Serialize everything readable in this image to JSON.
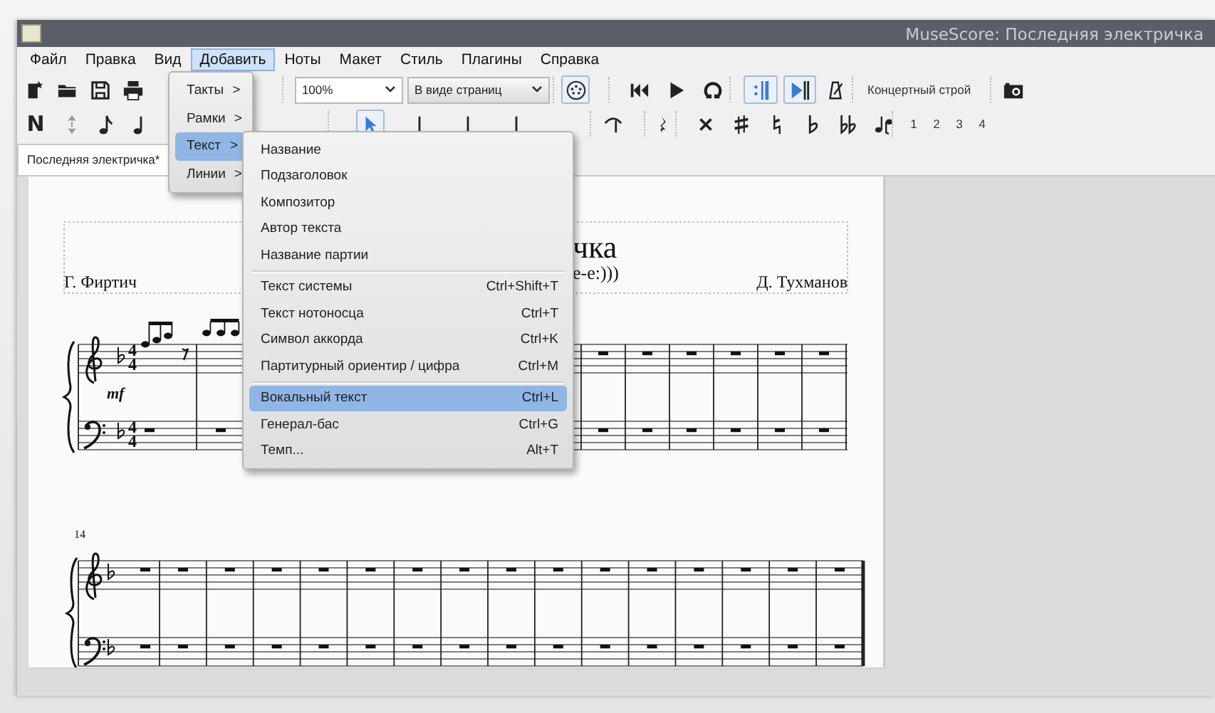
{
  "window": {
    "title": "MuseScore: Последняя электричка"
  },
  "menubar": [
    {
      "label": "Файл",
      "selected": false
    },
    {
      "label": "Правка",
      "selected": false
    },
    {
      "label": "Вид",
      "selected": false
    },
    {
      "label": "Добавить",
      "selected": true
    },
    {
      "label": "Ноты",
      "selected": false
    },
    {
      "label": "Макет",
      "selected": false
    },
    {
      "label": "Стиль",
      "selected": false
    },
    {
      "label": "Плагины",
      "selected": false
    },
    {
      "label": "Справка",
      "selected": false
    }
  ],
  "toolbar_row_1": [
    [
      {
        "kind": "new-file"
      },
      {
        "kind": "open-folder"
      },
      {
        "kind": "save"
      },
      {
        "kind": "print"
      }
    ],
    [
      {
        "kind": "combo",
        "value": "100%"
      },
      {
        "kind": "combo",
        "value": "В виде страниц"
      }
    ],
    [
      {
        "kind": "midi",
        "on": true
      }
    ],
    [
      {
        "kind": "rewind"
      },
      {
        "kind": "play"
      },
      {
        "kind": "loop"
      }
    ],
    [
      {
        "kind": "repeat",
        "on": true
      },
      {
        "kind": "pan",
        "on": true
      },
      {
        "kind": "metronome",
        "on": false
      }
    ],
    [
      {
        "kind": "text-toggle",
        "label": "Концертный строй",
        "on": false
      }
    ],
    [
      {
        "kind": "camera"
      }
    ]
  ],
  "toolbar_row_2": [
    [
      {
        "kind": "glyph",
        "text": "N",
        "on": false
      },
      {
        "kind": "up-down"
      },
      {
        "kind": "eighth-note"
      },
      {
        "kind": "quarter-note"
      }
    ],
    [
      {
        "kind": "cursor-note",
        "on": true
      },
      {
        "kind": "stem"
      },
      {
        "kind": "stem"
      },
      {
        "kind": "stem"
      }
    ],
    [
      {
        "kind": "hook"
      }
    ],
    [
      {
        "kind": "rest"
      }
    ],
    [
      {
        "kind": "double-sharp"
      },
      {
        "kind": "sharp"
      },
      {
        "kind": "natural"
      },
      {
        "kind": "flat"
      },
      {
        "kind": "double-flat"
      },
      {
        "kind": "flip"
      }
    ],
    [
      {
        "kind": "voice",
        "text": "1"
      },
      {
        "kind": "voice",
        "text": "2"
      },
      {
        "kind": "voice",
        "text": "3"
      },
      {
        "kind": "voice",
        "text": "4"
      }
    ]
  ],
  "tabs": [
    {
      "label": "Последняя электричка*",
      "selected": true
    }
  ],
  "score": {
    "title": "чка",
    "subtitle": "e-e:)))",
    "lyricist": "Г. Фиртич",
    "composer": "Д. Тухманов",
    "treble_time_signature": [
      "4",
      "4"
    ],
    "bass_time_signature": [
      "4",
      "4"
    ],
    "dynamic": "mf",
    "measure_number": "14"
  },
  "add_menu": [
    {
      "label": "Такты",
      "arrow": ">",
      "selected": false
    },
    {
      "label": "Рамки",
      "arrow": ">",
      "selected": false
    },
    {
      "label": "Текст",
      "arrow": ">",
      "selected": true
    },
    {
      "label": "Линии",
      "arrow": ">",
      "selected": false
    }
  ],
  "text_submenu": [
    [
      {
        "label": "Название",
        "selected": false
      },
      {
        "label": "Подзаголовок",
        "selected": false
      },
      {
        "label": "Композитор",
        "selected": false
      },
      {
        "label": "Автор текста",
        "selected": false
      },
      {
        "label": "Название партии",
        "selected": false
      }
    ],
    [
      {
        "label": "Текст системы",
        "shortcut": "Ctrl+Shift+T",
        "selected": false
      },
      {
        "label": "Текст нотоносца",
        "shortcut": "Ctrl+T",
        "selected": false
      },
      {
        "label": "Символ аккорда",
        "shortcut": "Ctrl+K",
        "selected": false
      },
      {
        "label": "Партитурный ориентир / цифра",
        "shortcut": "Ctrl+M",
        "selected": false
      }
    ],
    [
      {
        "label": "Вокальный текст",
        "shortcut": "Ctrl+L",
        "selected": true
      },
      {
        "label": "Генерал-бас",
        "shortcut": "Ctrl+G",
        "selected": false
      },
      {
        "label": "Темп...",
        "shortcut": "Alt+T",
        "selected": false
      }
    ]
  ]
}
